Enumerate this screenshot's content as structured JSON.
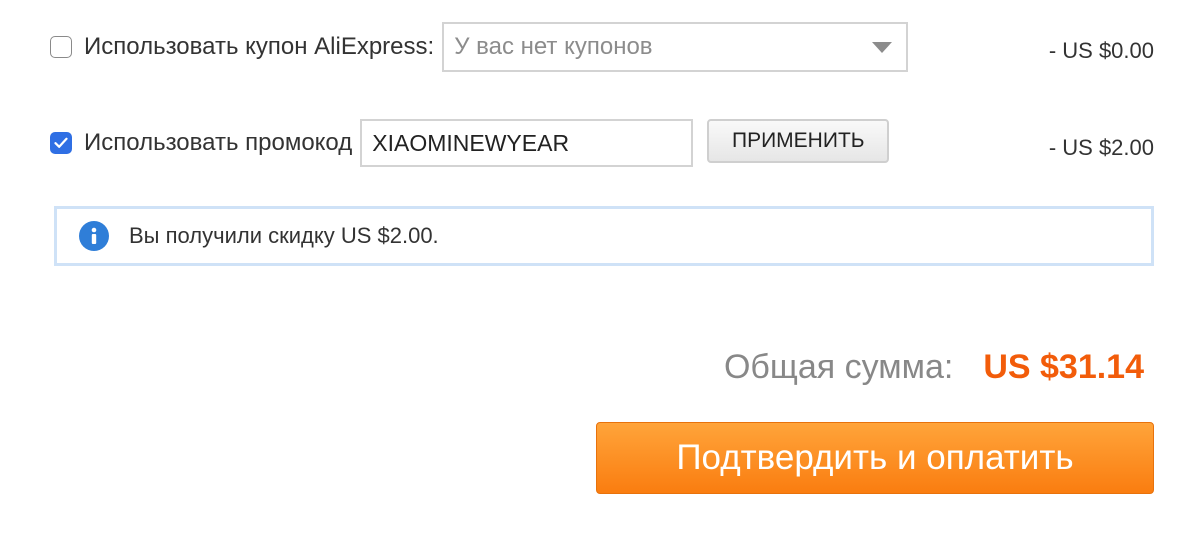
{
  "coupon": {
    "checked": false,
    "label": "Использовать купон AliExpress:",
    "select_value": "У вас нет купонов",
    "discount": "- US $0.00"
  },
  "promo": {
    "checked": true,
    "label": "Использовать промокод",
    "code": "XIAOMINEWYEAR",
    "apply_label": "ПРИМЕНИТЬ",
    "discount": "- US $2.00"
  },
  "info": {
    "icon": "info-icon",
    "message": "Вы получили скидку US $2.00."
  },
  "total": {
    "label": "Общая сумма:",
    "value": "US $31.14"
  },
  "confirm": {
    "label": "Подтвердить и оплатить"
  },
  "colors": {
    "accent_orange": "#f25c0a",
    "button_orange": "#fa7d10",
    "checkbox_blue": "#2f6fe4",
    "info_blue": "#2f7ed8",
    "info_border": "#cfe2f7"
  }
}
